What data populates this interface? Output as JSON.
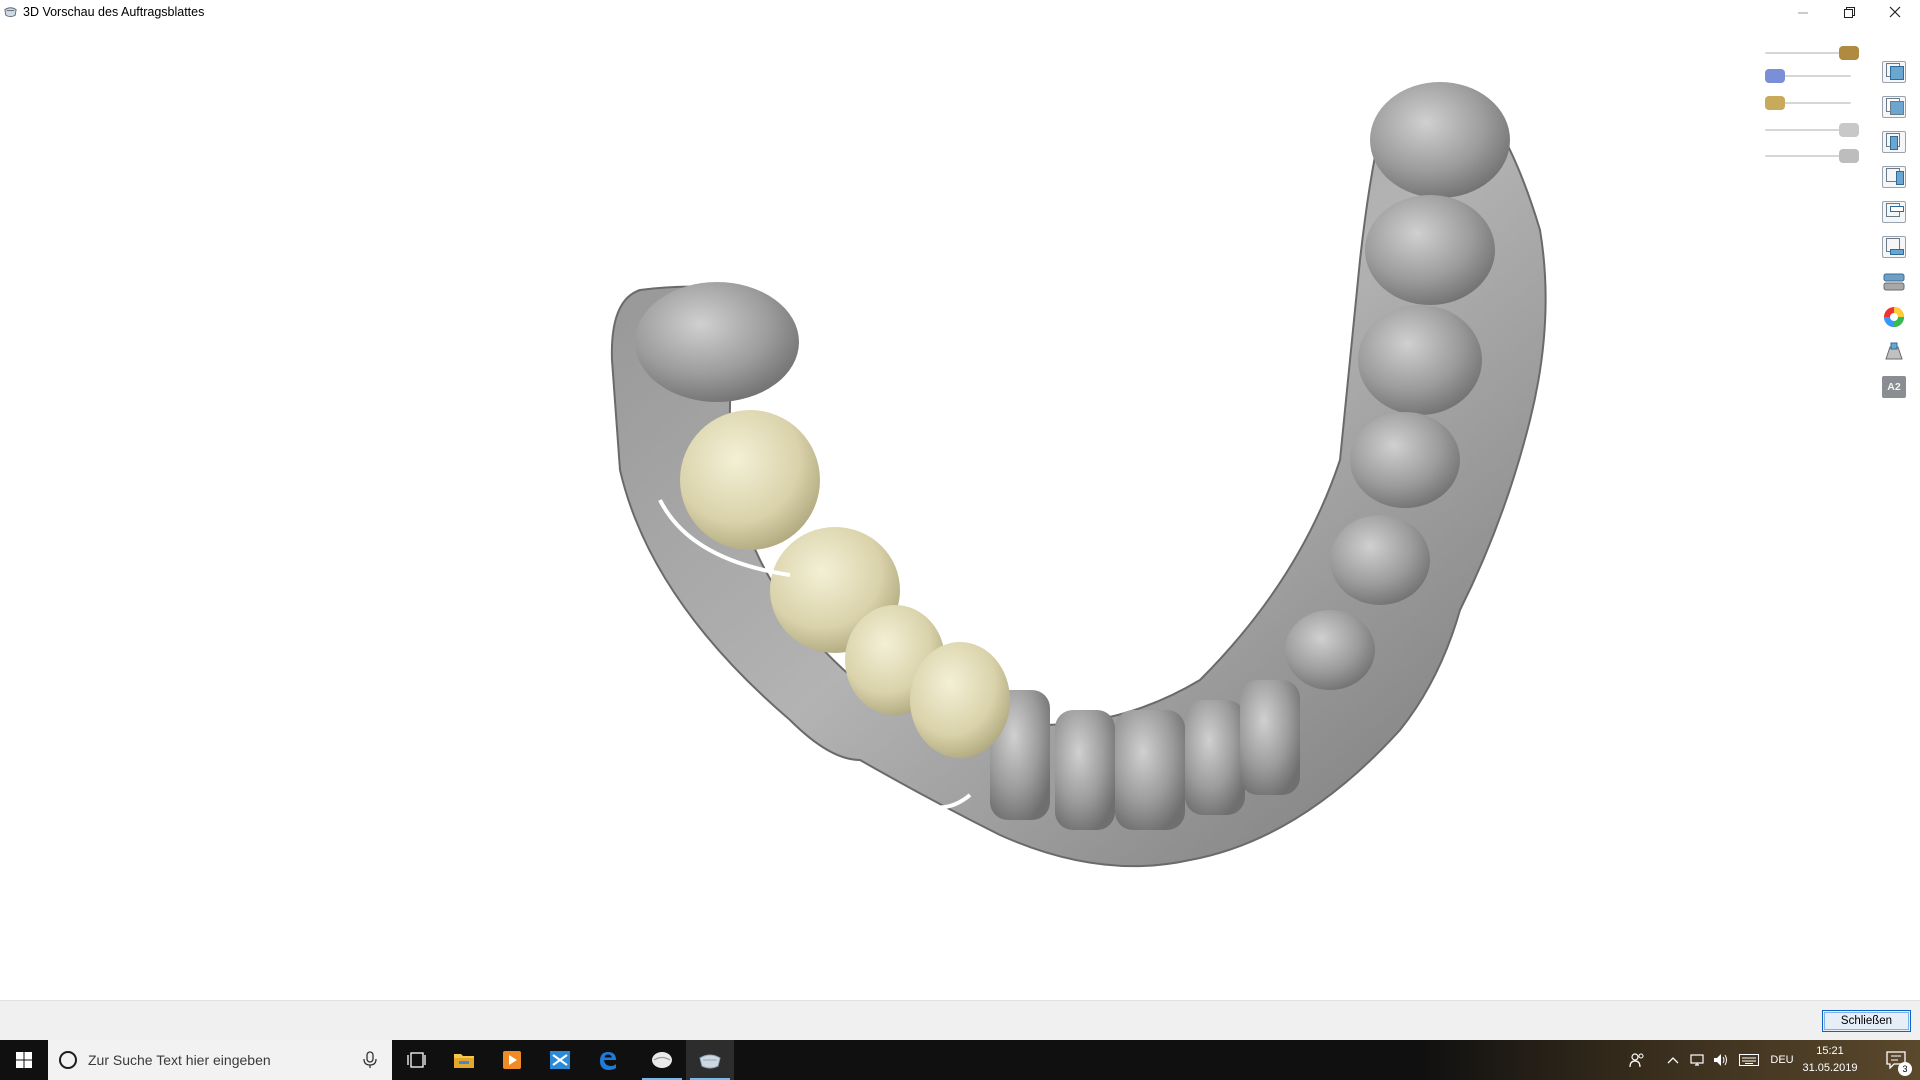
{
  "window": {
    "title": "3D Vorschau des Auftragsblattes",
    "app_icon": "dental-model-icon",
    "controls": [
      "minimize-icon",
      "restore-icon",
      "close-icon"
    ]
  },
  "viewport": {
    "scene": "dental-arch-model",
    "background_color": "#ffffff",
    "model_color": "#9a9a9a",
    "restoration_color": "#dcd6b0",
    "sliders": [
      {
        "name": "antagonist-opacity",
        "value": 1.0,
        "icon": "antagonist-icon",
        "color": "#b08a40"
      },
      {
        "name": "jaw-opacity",
        "value": 0.0,
        "icon": "jaw-icon",
        "color": "#7a8fd8"
      },
      {
        "name": "restoration-opacity",
        "value": 0.0,
        "icon": "restoration-icon",
        "color": "#c9a95a"
      },
      {
        "name": "gingiva-opacity",
        "value": 1.0,
        "icon": "gingiva-icon",
        "color": "#c8c8c8"
      },
      {
        "name": "tooth-opacity",
        "value": 1.0,
        "icon": "tooth-icon",
        "color": "#bdbdbd"
      }
    ],
    "toolbar": [
      {
        "name": "view-front-button",
        "icon": "cube-front-icon"
      },
      {
        "name": "view-back-button",
        "icon": "cube-back-icon"
      },
      {
        "name": "view-left-button",
        "icon": "cube-left-icon"
      },
      {
        "name": "view-right-button",
        "icon": "cube-right-icon"
      },
      {
        "name": "view-top-button",
        "icon": "cube-top-icon"
      },
      {
        "name": "view-bottom-button",
        "icon": "cube-bottom-icon"
      },
      {
        "name": "occlusion-view-button",
        "icon": "articulator-icon"
      },
      {
        "name": "color-map-button",
        "icon": "color-wheel-icon"
      },
      {
        "name": "distance-button",
        "icon": "measure-icon"
      },
      {
        "name": "shade-button",
        "icon": "shade-icon",
        "label": "A2"
      }
    ]
  },
  "footer": {
    "close_label": "Schließen"
  },
  "taskbar": {
    "search_placeholder": "Zur Suche Text hier eingeben",
    "apps": [
      "task-view-icon",
      "file-explorer-icon",
      "media-player-icon",
      "app-store-icon",
      "edge-icon",
      "dental-app-icon",
      "dental-preview-icon"
    ],
    "language": "DEU",
    "time": "15:21",
    "date": "31.05.2019",
    "notifications": "3"
  }
}
